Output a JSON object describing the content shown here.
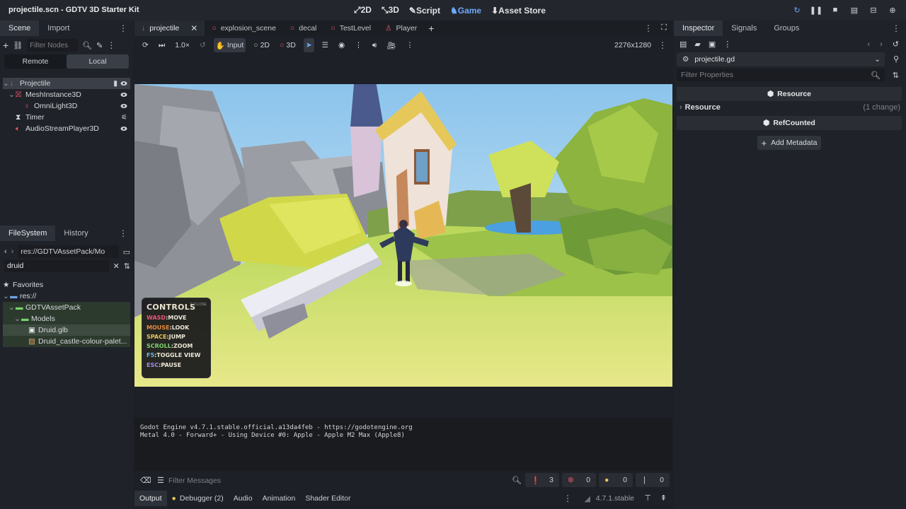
{
  "window": {
    "title": "projectile.scn - GDTV 3D Starter Kit"
  },
  "modes": [
    {
      "label": "2D",
      "active": false
    },
    {
      "label": "3D",
      "active": false
    },
    {
      "label": "Script",
      "active": false
    },
    {
      "label": "Game",
      "active": true
    },
    {
      "label": "Asset Store",
      "active": false
    }
  ],
  "scene_dock": {
    "tabs": [
      "Scene",
      "Import"
    ],
    "filter_placeholder": "Filter Nodes",
    "remote_label": "Remote",
    "local_label": "Local",
    "tree": [
      {
        "label": "Projectile",
        "icon": "arrow-down-icon",
        "color": "#e8566a"
      },
      {
        "label": "MeshInstance3D",
        "icon": "mesh-icon",
        "color": "#e8566a"
      },
      {
        "label": "OmniLight3D",
        "icon": "light-icon",
        "color": "#e8566a"
      },
      {
        "label": "Timer",
        "icon": "timer-icon",
        "color": "#d6d8dc"
      },
      {
        "label": "AudioStreamPlayer3D",
        "icon": "audio-icon",
        "color": "#e8566a"
      }
    ]
  },
  "filesystem_dock": {
    "tabs": [
      "FileSystem",
      "History"
    ],
    "path": "res://GDTVAssetPack/Mo",
    "search_value": "druid",
    "tree": [
      {
        "label": "Favorites",
        "icon": "star-icon"
      },
      {
        "label": "res://",
        "icon": "folder-icon"
      },
      {
        "label": "GDTVAssetPack",
        "icon": "folder-icon"
      },
      {
        "label": "Models",
        "icon": "folder-icon"
      },
      {
        "label": "Druid.glb",
        "icon": "scene-file-icon"
      },
      {
        "label": "Druid_castle-colour-palet...",
        "icon": "image-file-icon"
      }
    ]
  },
  "scene_tabs": [
    {
      "label": "projectile",
      "active": true
    },
    {
      "label": "explosion_scene",
      "active": false
    },
    {
      "label": "decal",
      "active": false
    },
    {
      "label": "TestLevel",
      "active": false
    },
    {
      "label": "Player",
      "active": false
    }
  ],
  "viewport_toolbar": {
    "speed": "1.0×",
    "input_label": "Input",
    "mode_2d": "2D",
    "mode_3d": "3D",
    "resolution": "2276x1280"
  },
  "game_controls": {
    "title": "CONTROLS",
    "close_hint": "F CLOSE",
    "lines": [
      {
        "key": "WASD",
        "action": "MOVE"
      },
      {
        "key": "MOUSE",
        "action": "LOOK"
      },
      {
        "key": "SPACE",
        "action": "JUMP"
      },
      {
        "key": "SCROLL",
        "action": "ZOOM"
      },
      {
        "key": "F5",
        "action": "TOGGLE VIEW"
      },
      {
        "key": "ESC",
        "action": "PAUSE"
      }
    ]
  },
  "output": {
    "lines": [
      "Godot Engine v4.7.1.stable.official.a13da4feb - https://godotengine.org",
      "Metal 4.0 - Forward+ - Using Device #0: Apple - Apple M2 Max (Apple8)"
    ],
    "filter_placeholder": "Filter Messages",
    "counts": {
      "messages": "3",
      "errors": "0",
      "warnings": "0",
      "info": "0"
    }
  },
  "bottom_tabs": [
    "Output",
    "Debugger (2)",
    "Audio",
    "Animation",
    "Shader Editor"
  ],
  "version": "4.7.1.stable",
  "inspector": {
    "tabs": [
      "Inspector",
      "Signals",
      "Groups"
    ],
    "resource_name": "projectile.gd",
    "filter_placeholder": "Filter Properties",
    "section_resource": "Resource",
    "row_resource_label": "Resource",
    "row_resource_change": "(1 change)",
    "section_refcounted": "RefCounted",
    "add_metadata": "Add Metadata"
  }
}
